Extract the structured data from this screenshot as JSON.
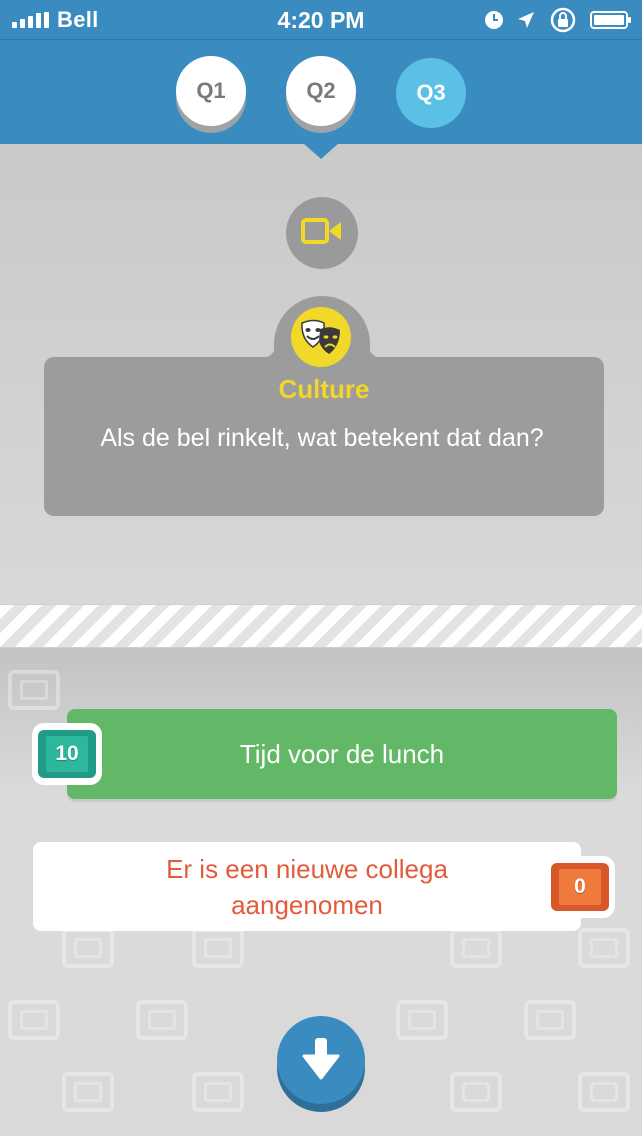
{
  "status_bar": {
    "carrier": "Bell",
    "time": "4:20 PM",
    "icons": [
      "signal-icon",
      "alarm-icon",
      "location-icon",
      "rotation-lock-icon",
      "battery-icon"
    ]
  },
  "tabs": [
    {
      "label": "Q1",
      "state": "inactive"
    },
    {
      "label": "Q2",
      "state": "inactive"
    },
    {
      "label": "Q3",
      "state": "active"
    }
  ],
  "question": {
    "video_icon": "video-camera-icon",
    "category_icon": "theater-masks-icon",
    "category": "Culture",
    "text": "Als de bel rinkelt, wat betekent dat dan?"
  },
  "answers": [
    {
      "text": "Tijd voor de lunch",
      "score": "10",
      "state": "correct",
      "gem_color": "#2db79d"
    },
    {
      "text": "Er is een nieuwe collega aangenomen",
      "score": "0",
      "state": "wrong",
      "gem_color": "#ef7a3d"
    }
  ],
  "next_button": {
    "icon": "arrow-down-icon"
  },
  "colors": {
    "primary": "#3a8bbf",
    "active_tab": "#5bc0e6",
    "category": "#f2d62a",
    "correct": "#62b866",
    "wrong_text": "#e35b3b"
  }
}
